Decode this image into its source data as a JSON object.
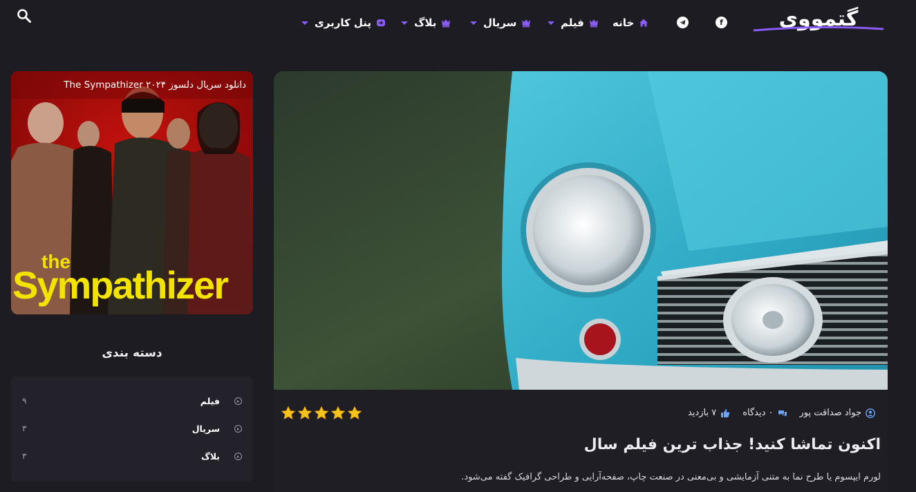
{
  "header": {
    "logo_text": "گتمووی",
    "nav": [
      {
        "label": "خانه",
        "icon": "home-icon",
        "has_dropdown": false
      },
      {
        "label": "فیلم",
        "icon": "crown-icon",
        "has_dropdown": true
      },
      {
        "label": "سریال",
        "icon": "crown-icon",
        "has_dropdown": true
      },
      {
        "label": "بلاگ",
        "icon": "crown-icon",
        "has_dropdown": true
      },
      {
        "label": "پنل کاربری",
        "icon": "login-icon",
        "has_dropdown": true
      }
    ],
    "social": [
      "telegram-icon",
      "facebook-icon"
    ],
    "search_icon": "search-icon",
    "accent_color": "#8a5cf6"
  },
  "post": {
    "author": "جواد صداقت پور",
    "comments": "۰ دیدگاه",
    "views": "۷ بازدید",
    "rating": 5,
    "title": "اکنون تماشا کنید! جذاب ترین فیلم سال",
    "excerpt": "لورم ایپسوم یا طرح نما به متنی آزمایشی و بی‌معنی در صنعت چاپ، صفحه‌آرایی و طراحی گرافیک گفته می‌شود."
  },
  "sidebar": {
    "poster_caption": "دانلود سریال دلسوز The Sympathizer ۲۰۲۴",
    "poster_title_small": "the",
    "poster_title_big": "Sympathizer",
    "categories_title": "دسته بندی",
    "categories": [
      {
        "label": "فیلم",
        "count": "۹"
      },
      {
        "label": "سریال",
        "count": "۳"
      },
      {
        "label": "بلاگ",
        "count": "۳"
      }
    ]
  }
}
